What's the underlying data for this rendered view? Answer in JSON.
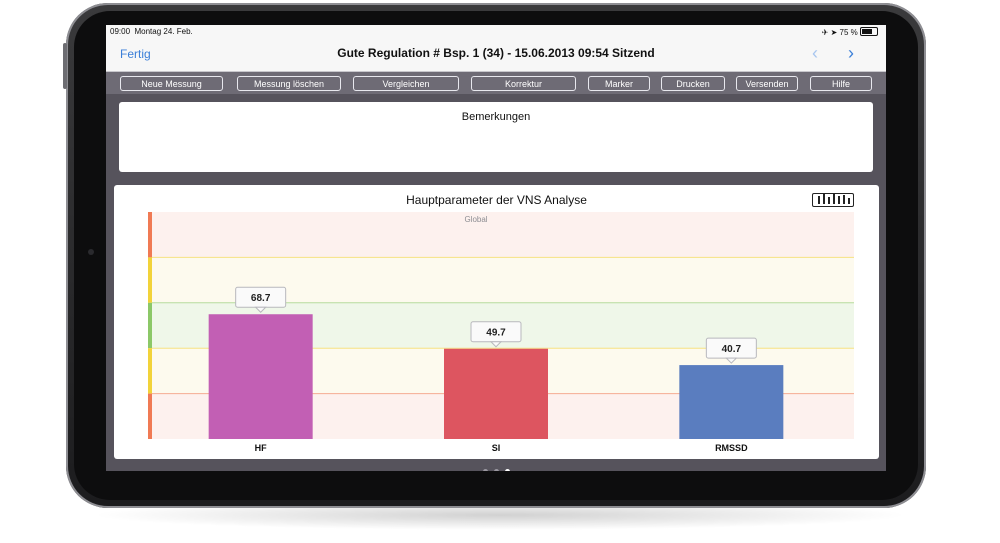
{
  "status": {
    "time": "09:00",
    "date": "Montag 24. Feb.",
    "battery": "75 %"
  },
  "nav": {
    "back_label": "Fertig",
    "title": "Gute Regulation # Bsp. 1 (34) - 15.06.2013 09:54 Sitzend",
    "prev_glyph": "‹",
    "next_glyph": "›"
  },
  "toolbar": {
    "buttons": [
      {
        "label": "Neue Messung"
      },
      {
        "label": "Messung löschen"
      },
      {
        "label": "Vergleichen"
      },
      {
        "label": "Korrektur"
      },
      {
        "label": "Marker"
      },
      {
        "label": "Drucken"
      },
      {
        "label": "Versenden"
      },
      {
        "label": "Hilfe"
      }
    ]
  },
  "remarks": {
    "title": "Bemerkungen"
  },
  "chart_card": {
    "title": "Hauptparameter der VNS Analyse",
    "icon": "bar-chart-icon"
  },
  "chart_data": {
    "type": "bar",
    "title": "Global",
    "categories": [
      "HF",
      "SI",
      "RMSSD"
    ],
    "values": [
      68.7,
      49.7,
      40.7
    ],
    "colors": [
      "#c25fb4",
      "#dd5560",
      "#5a7dbf"
    ],
    "zone_colors": [
      "#f07a54",
      "#f2d33a",
      "#8cc868",
      "#f2d33a",
      "#f07a54"
    ],
    "zone_fills": [
      "#fdf1ee",
      "#fdfaee",
      "#eff7e9",
      "#fdfaee",
      "#fdf1ee"
    ],
    "ylim": [
      0,
      100
    ],
    "grid": true
  },
  "colors": {
    "accent": "#3b7fd8",
    "toolbar_bg": "#6e6b75",
    "content_bg": "#56535c"
  },
  "pager": {
    "count": 3,
    "active": 2
  }
}
